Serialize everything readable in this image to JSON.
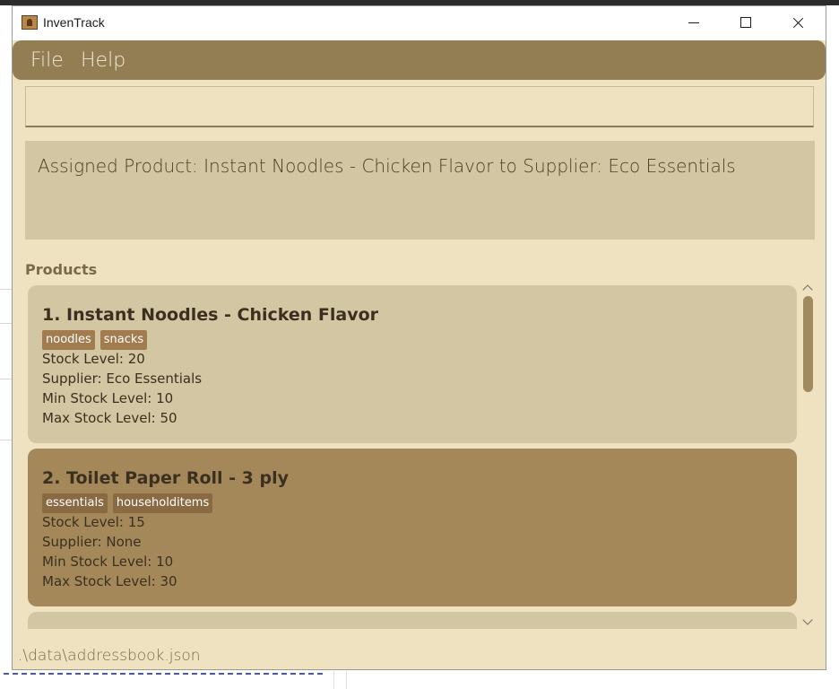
{
  "window": {
    "title": "InvenTrack"
  },
  "menu": {
    "file": "File",
    "help": "Help"
  },
  "command": {
    "value": ""
  },
  "result": {
    "message": "Assigned Product: Instant Noodles - Chicken Flavor to Supplier: Eco Essentials"
  },
  "products": {
    "label": "Products",
    "items": [
      {
        "name": "1. Instant Noodles - Chicken Flavor",
        "tags": [
          "noodles",
          "snacks"
        ],
        "stock": "Stock Level: 20",
        "supplier": "Supplier: Eco Essentials",
        "min": "Min Stock Level: 10",
        "max": "Max Stock Level: 50"
      },
      {
        "name": "2. Toilet Paper Roll - 3 ply",
        "tags": [
          "essentials",
          "householditems"
        ],
        "stock": "Stock Level: 15",
        "supplier": "Supplier: None",
        "min": "Min Stock Level: 10",
        "max": "Max Stock Level: 30"
      }
    ]
  },
  "status": {
    "path": ".\\data\\addressbook.json"
  },
  "colors": {
    "window_bg": "#efe2c1",
    "menu_bar": "#937d52",
    "card_default": "#d3c6a2",
    "card_selected": "#a5885a",
    "tag": "#a27c4f"
  }
}
